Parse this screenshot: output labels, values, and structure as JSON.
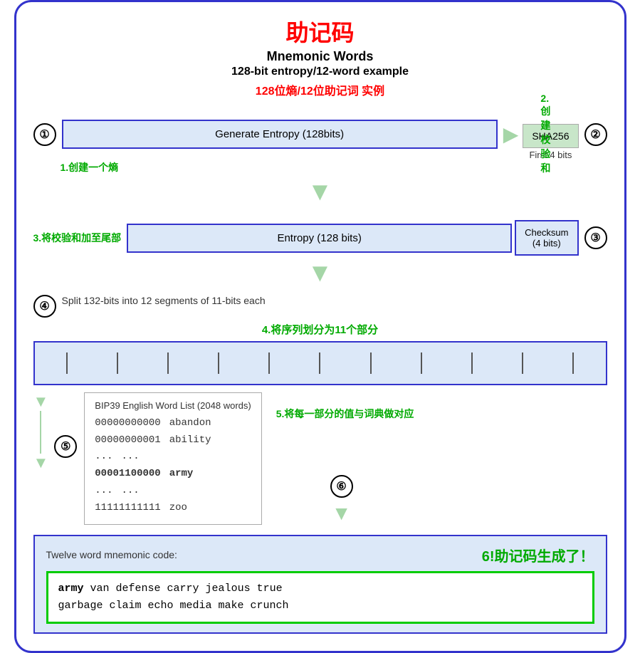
{
  "title": {
    "chinese": "助记码",
    "english": "Mnemonic Words",
    "subtitle_en": "128-bit entropy/12-word example",
    "subtitle_zh": "128位熵/12位助记词 实例"
  },
  "labels": {
    "label1": "1.创建一个熵",
    "label2": "2.创建校验和",
    "label3": "3.将校验和加至尾部",
    "label4": "4.将序列划分为11个部分",
    "label5": "5.将每一部分的值与词典做对应",
    "label6": "6!助记码生成了！"
  },
  "section1": {
    "circle": "①",
    "box_text": "Generate Entropy (128bits)",
    "sha_label": "SHA256",
    "first_bits": "First 4 bits",
    "circle2": "②"
  },
  "section3": {
    "entropy_label": "Entropy (128 bits)",
    "checksum_label": "Checksum\n(4 bits)",
    "circle": "③"
  },
  "section4": {
    "circle": "④",
    "split_text": "Split 132-bits into 12 segments of 11-bits each"
  },
  "section5": {
    "circle": "⑤",
    "wordlist_title": "BIP39 English Word List (2048 words)",
    "entries": [
      {
        "code": "00000000000",
        "word": "abandon"
      },
      {
        "code": "00000000001",
        "word": "ability"
      },
      {
        "code": "...",
        "word": "..."
      },
      {
        "code": "00001100000",
        "word": "army",
        "highlight": true
      },
      {
        "code": "...",
        "word": "..."
      },
      {
        "code": "11111111111",
        "word": "zoo"
      }
    ],
    "circle6": "⑥"
  },
  "section6": {
    "twelve_word_label": "Twelve word mnemonic code:",
    "mnemonic": "army van defense carry jealous true garbage claim echo media make crunch",
    "mnemonic_line1": "army van defense carry jealous true",
    "mnemonic_line2": "garbage claim echo media make crunch"
  }
}
